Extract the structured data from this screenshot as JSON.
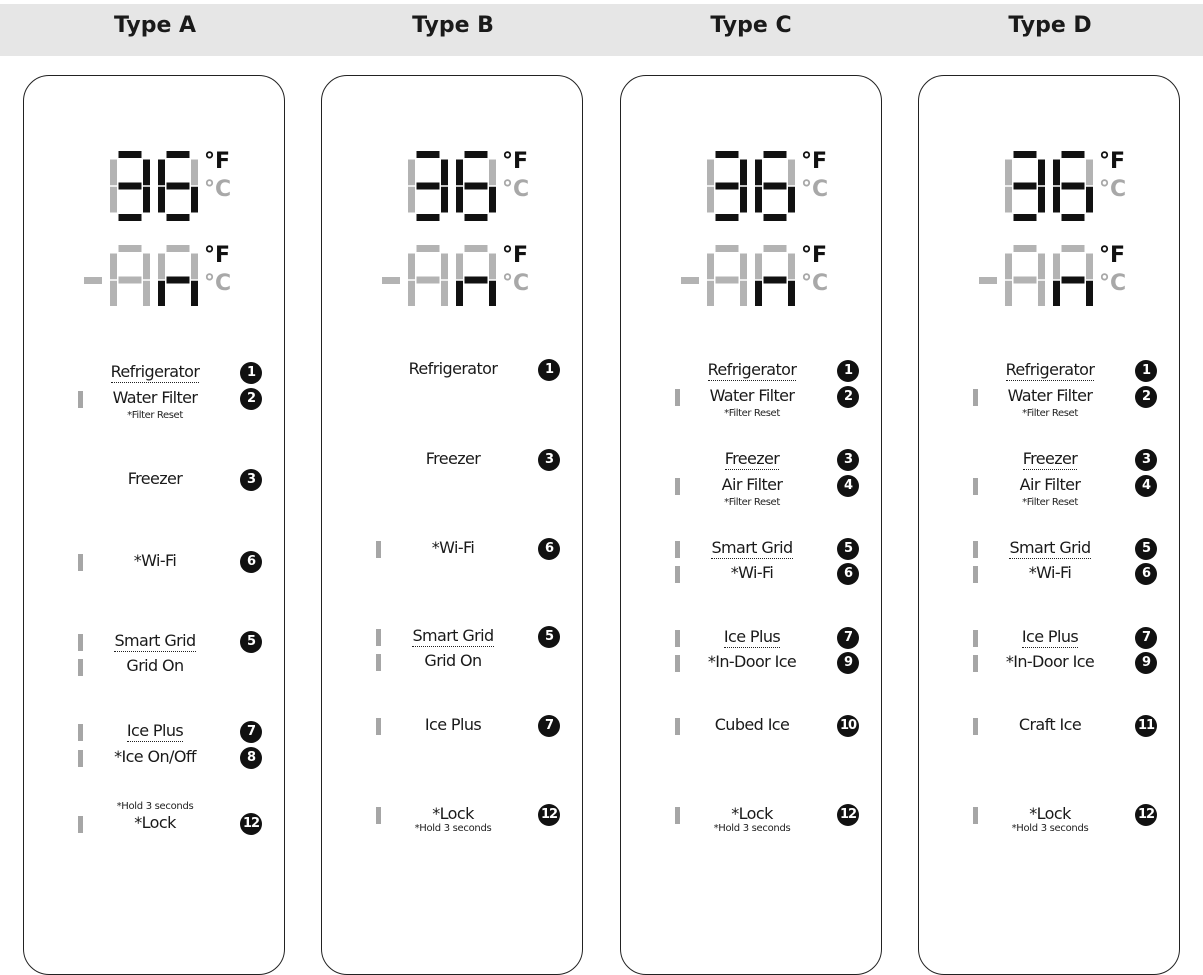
{
  "panels": [
    {
      "title": "Type A",
      "temp_top": {
        "unit_f": "°F",
        "unit_c": "°C"
      },
      "temp_bottom": {
        "unit_f": "°F",
        "unit_c": "°C"
      },
      "rows": [
        {
          "label": "Refrigerator",
          "marker": "1",
          "underline": true,
          "bar": false
        },
        {
          "label": "Water Filter",
          "marker": "2",
          "bar": true,
          "sub": "*Filter Reset"
        },
        {
          "label": "Freezer",
          "marker": "3",
          "bar": false
        },
        {
          "label": "*Wi-Fi",
          "marker": "6",
          "bar": true
        },
        {
          "label": "Smart Grid",
          "marker": "5",
          "underline": true,
          "bar": true
        },
        {
          "label": "Grid On",
          "marker": "",
          "bar": true
        },
        {
          "label": "Ice Plus",
          "marker": "7",
          "underline": true,
          "bar": true
        },
        {
          "label": "*Ice On/Off",
          "marker": "8",
          "bar": true
        },
        {
          "label": "*Lock",
          "marker": "12",
          "bar": true
        }
      ],
      "hold_note": "*Hold 3 seconds"
    },
    {
      "title": "Type B",
      "temp_top": {
        "unit_f": "°F",
        "unit_c": "°C"
      },
      "temp_bottom": {
        "unit_f": "°F",
        "unit_c": "°C"
      },
      "rows": [
        {
          "label": "Refrigerator",
          "marker": "1",
          "bar": false
        },
        {
          "label": "Freezer",
          "marker": "3",
          "bar": false
        },
        {
          "label": "*Wi-Fi",
          "marker": "6",
          "bar": true
        },
        {
          "label": "Smart Grid",
          "marker": "5",
          "underline": true,
          "bar": true
        },
        {
          "label": "Grid On",
          "marker": "",
          "bar": true
        },
        {
          "label": "Ice Plus",
          "marker": "7",
          "bar": true
        },
        {
          "label": "*Lock",
          "marker": "12",
          "bar": true
        }
      ],
      "hold_note": "*Hold 3 seconds"
    },
    {
      "title": "Type C",
      "temp_top": {
        "unit_f": "°F",
        "unit_c": "°C"
      },
      "temp_bottom": {
        "unit_f": "°F",
        "unit_c": "°C"
      },
      "rows": [
        {
          "label": "Refrigerator",
          "marker": "1",
          "underline": true,
          "bar": false
        },
        {
          "label": "Water Filter",
          "marker": "2",
          "bar": true,
          "sub": "*Filter Reset"
        },
        {
          "label": "Freezer",
          "marker": "3",
          "underline": true,
          "bar": false
        },
        {
          "label": "Air Filter",
          "marker": "4",
          "bar": true,
          "sub": "*Filter Reset"
        },
        {
          "label": "Smart Grid",
          "marker": "5",
          "underline": true,
          "bar": true
        },
        {
          "label": "*Wi-Fi",
          "marker": "6",
          "bar": true
        },
        {
          "label": "Ice Plus",
          "marker": "7",
          "underline": true,
          "bar": true
        },
        {
          "label": "*In-Door Ice",
          "marker": "9",
          "bar": true
        },
        {
          "label": "Cubed Ice",
          "marker": "10",
          "bar": true
        },
        {
          "label": "*Lock",
          "marker": "12",
          "bar": true
        }
      ],
      "hold_note": "*Hold 3 seconds"
    },
    {
      "title": "Type D",
      "temp_top": {
        "unit_f": "°F",
        "unit_c": "°C"
      },
      "temp_bottom": {
        "unit_f": "°F",
        "unit_c": "°C"
      },
      "rows": [
        {
          "label": "Refrigerator",
          "marker": "1",
          "underline": true,
          "bar": false
        },
        {
          "label": "Water Filter",
          "marker": "2",
          "bar": true,
          "sub": "*Filter Reset"
        },
        {
          "label": "Freezer",
          "marker": "3",
          "underline": true,
          "bar": false
        },
        {
          "label": "Air Filter",
          "marker": "4",
          "bar": true,
          "sub": "*Filter Reset"
        },
        {
          "label": "Smart Grid",
          "marker": "5",
          "underline": true,
          "bar": true
        },
        {
          "label": "*Wi-Fi",
          "marker": "6",
          "bar": true
        },
        {
          "label": "Ice Plus",
          "marker": "7",
          "underline": true,
          "bar": true
        },
        {
          "label": "*In-Door Ice",
          "marker": "9",
          "bar": true
        },
        {
          "label": "Craft Ice",
          "marker": "11",
          "bar": true
        },
        {
          "label": "*Lock",
          "marker": "12",
          "bar": true
        }
      ],
      "hold_note": "*Hold 3 seconds"
    }
  ],
  "colors": {
    "segment_on": "#111111",
    "segment_off": "#b3b3b3",
    "unit_off": "#a8a8a8",
    "header_bg": "#e6e6e6"
  }
}
